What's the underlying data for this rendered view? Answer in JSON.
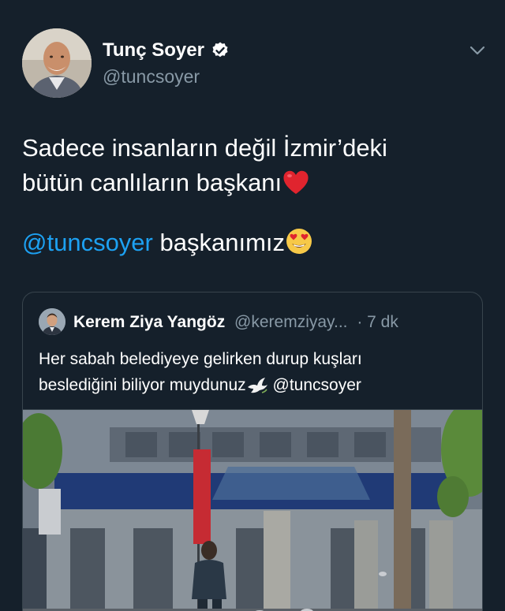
{
  "tweet": {
    "author_name": "Tunç Soyer",
    "author_handle": "@tuncsoyer",
    "text_line1": "Sadece insanların değil İzmir’deki",
    "text_line2": "bütün canlıların başkanı",
    "mention": "@tuncsoyer",
    "text_after_mention": " başkanımız",
    "icons": [
      "verified-badge-icon",
      "chevron-down-icon",
      "red-heart-emoji",
      "heart-eyes-emoji"
    ],
    "colors": {
      "background": "#15202b",
      "mention": "#1da1f2",
      "muted": "#8899a6",
      "border": "#38444d"
    }
  },
  "quoted_tweet": {
    "author_name": "Kerem Ziya Yangöz",
    "author_handle": "@keremziyay...",
    "time": "· 7 dk",
    "text_line1": "Her sabah belediyeye gelirken durup kuşları",
    "text_line2": "beslediğini biliyor muydunuz",
    "mention": "@tuncsoyer",
    "icons": [
      "dove-emoji"
    ]
  }
}
